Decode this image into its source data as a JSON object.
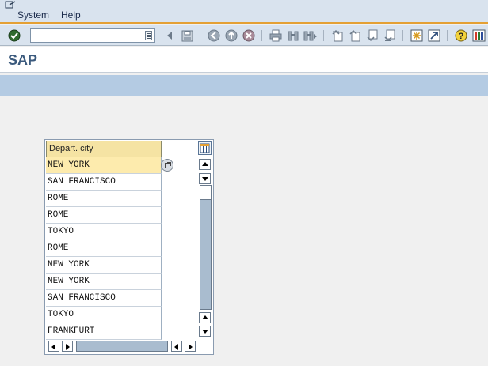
{
  "menu": {
    "items": [
      {
        "label": "System",
        "accel": "S"
      },
      {
        "label": "Help",
        "accel": "H"
      }
    ]
  },
  "toolbar": {
    "command_field_value": "",
    "icons": [
      "enter-icon",
      "history-icon",
      "back-arrow-icon",
      "save-icon",
      "back-icon",
      "exit-icon",
      "cancel-icon",
      "print-icon",
      "find-icon",
      "find-next-icon",
      "first-page-icon",
      "previous-page-icon",
      "next-page-icon",
      "last-page-icon",
      "create-session-icon",
      "shortcut-icon",
      "help-icon",
      "customize-layout-icon"
    ]
  },
  "title": "SAP",
  "value_help": {
    "column_header": "Depart. city",
    "rows": [
      "NEW YORK",
      "SAN FRANCISCO",
      "ROME",
      "ROME",
      "TOKYO",
      "ROME",
      "NEW YORK",
      "NEW YORK",
      "SAN FRANCISCO",
      "TOKYO",
      "FRANKFURT"
    ],
    "selected_index": 0
  },
  "colors": {
    "menubar_bg": "#d9e3ee",
    "accent_line": "#e4a034",
    "appbar_bg": "#b4cbe3",
    "selected_row": "#fdebad",
    "header_bg": "#f5e3a3",
    "title_text": "#3b5a7d"
  }
}
